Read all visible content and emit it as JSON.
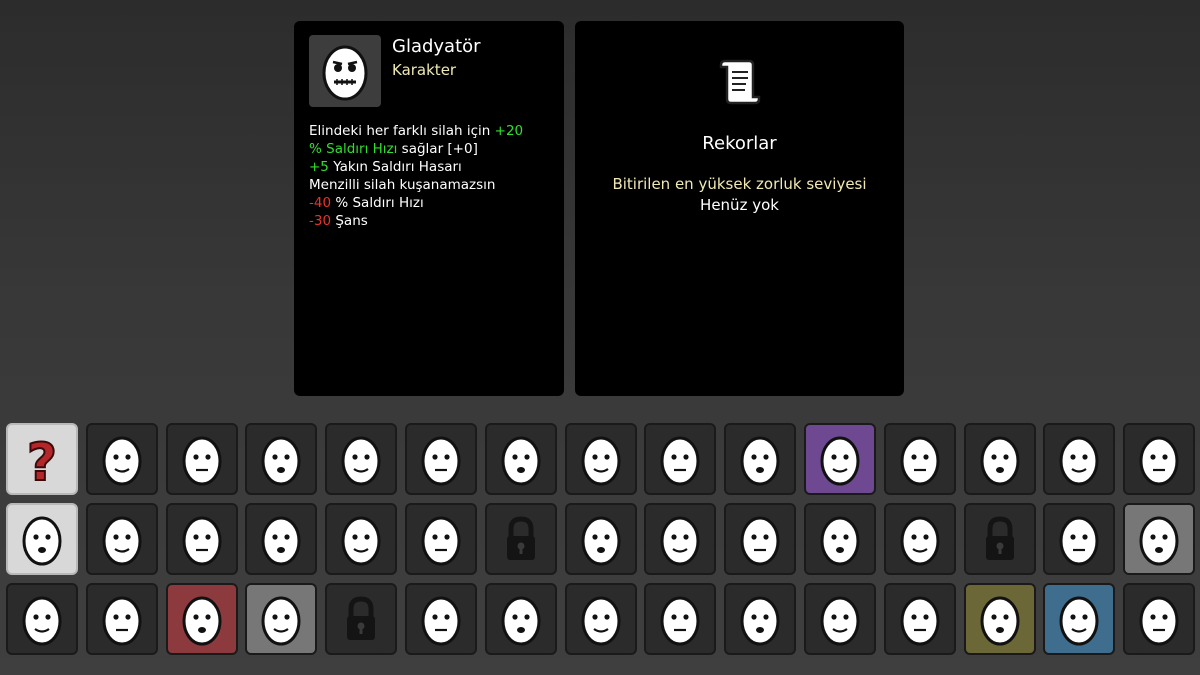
{
  "character": {
    "name": "Gladyatör",
    "type": "Karakter",
    "effects": [
      {
        "parts": [
          {
            "t": "Elindeki her farklı silah için ",
            "c": "w"
          },
          {
            "t": "+20",
            "c": "pos"
          }
        ]
      },
      {
        "parts": [
          {
            "t": "% Saldırı Hızı",
            "c": "pos"
          },
          {
            "t": " sağlar [+0]",
            "c": "w"
          }
        ]
      },
      {
        "parts": [
          {
            "t": "+5",
            "c": "pos"
          },
          {
            "t": " Yakın Saldırı Hasarı",
            "c": "w"
          }
        ]
      },
      {
        "parts": [
          {
            "t": "Menzilli silah kuşanamazsın",
            "c": "w"
          }
        ]
      },
      {
        "parts": [
          {
            "t": "-40",
            "c": "neg"
          },
          {
            "t": " % Saldırı Hızı",
            "c": "w"
          }
        ]
      },
      {
        "parts": [
          {
            "t": "-30",
            "c": "neg"
          },
          {
            "t": " Şans",
            "c": "w"
          }
        ]
      }
    ]
  },
  "records": {
    "title": "Rekorlar",
    "label": "Bitirilen en yüksek zorluk seviyesi",
    "value": "Henüz yok"
  },
  "colors": {
    "positive": "#2ee02e",
    "negative": "#e8322c",
    "accent_text": "#f0e9b2"
  },
  "grid": {
    "rows": [
      [
        {
          "name": "random-character",
          "bg": "sel",
          "icon": "question-mark-icon"
        },
        {
          "name": "character-flat",
          "bg": "",
          "icon": "potato-face-icon"
        },
        {
          "name": "character-bruised",
          "bg": "",
          "icon": "potato-face-icon"
        },
        {
          "name": "character-smirk",
          "bg": "",
          "icon": "potato-face-icon"
        },
        {
          "name": "character-monocle",
          "bg": "",
          "icon": "potato-face-icon"
        },
        {
          "name": "character-bearded-elder",
          "bg": "",
          "icon": "potato-face-icon"
        },
        {
          "name": "character-surprised",
          "bg": "",
          "icon": "potato-face-icon"
        },
        {
          "name": "character-mustache",
          "bg": "",
          "icon": "potato-face-icon"
        },
        {
          "name": "character-wide-eyed",
          "bg": "",
          "icon": "potato-face-icon"
        },
        {
          "name": "character-multi-eyed",
          "bg": "",
          "icon": "potato-face-icon"
        },
        {
          "name": "character-angry-bearded",
          "bg": "purple",
          "icon": "potato-face-icon"
        },
        {
          "name": "character-open-mouth",
          "bg": "",
          "icon": "potato-face-icon"
        },
        {
          "name": "character-happy",
          "bg": "",
          "icon": "potato-face-icon"
        },
        {
          "name": "character-sad",
          "bg": "",
          "icon": "potato-face-icon"
        },
        {
          "name": "character-heart-eyes",
          "bg": "",
          "icon": "potato-face-icon"
        }
      ],
      [
        {
          "name": "character-gladiator",
          "bg": "sel",
          "icon": "potato-face-icon"
        },
        {
          "name": "character-plain",
          "bg": "",
          "icon": "potato-face-icon"
        },
        {
          "name": "character-sweaty",
          "bg": "",
          "icon": "potato-face-icon"
        },
        {
          "name": "character-goatee",
          "bg": "",
          "icon": "potato-face-icon"
        },
        {
          "name": "character-crying",
          "bg": "",
          "icon": "potato-face-icon"
        },
        {
          "name": "character-sleepy",
          "bg": "",
          "icon": "potato-face-icon"
        },
        {
          "name": "character-locked-1",
          "bg": "locked",
          "icon": "lock-icon"
        },
        {
          "name": "character-knight",
          "bg": "",
          "icon": "potato-face-icon"
        },
        {
          "name": "character-hairy",
          "bg": "",
          "icon": "potato-face-icon"
        },
        {
          "name": "character-masked",
          "bg": "",
          "icon": "potato-face-icon"
        },
        {
          "name": "character-ninja",
          "bg": "",
          "icon": "potato-face-icon"
        },
        {
          "name": "character-glasses-grin",
          "bg": "",
          "icon": "potato-face-icon"
        },
        {
          "name": "character-locked-2",
          "bg": "locked",
          "icon": "lock-icon"
        },
        {
          "name": "character-nerd",
          "bg": "",
          "icon": "potato-face-icon"
        },
        {
          "name": "character-viking",
          "bg": "gray",
          "icon": "potato-face-icon"
        }
      ],
      [
        {
          "name": "character-drooling",
          "bg": "",
          "icon": "potato-face-icon"
        },
        {
          "name": "character-grumpy",
          "bg": "",
          "icon": "potato-face-icon"
        },
        {
          "name": "character-demon",
          "bg": "red",
          "icon": "potato-face-icon"
        },
        {
          "name": "character-ghost",
          "bg": "gray",
          "icon": "potato-face-icon"
        },
        {
          "name": "character-locked-3",
          "bg": "locked",
          "icon": "lock-icon"
        },
        {
          "name": "character-ranger",
          "bg": "",
          "icon": "potato-face-icon"
        },
        {
          "name": "character-rock",
          "bg": "",
          "icon": "potato-face-icon"
        },
        {
          "name": "character-king",
          "bg": "",
          "icon": "potato-face-icon"
        },
        {
          "name": "character-mutant",
          "bg": "",
          "icon": "potato-face-icon"
        },
        {
          "name": "character-calm",
          "bg": "",
          "icon": "potato-face-icon"
        },
        {
          "name": "character-spiked",
          "bg": "",
          "icon": "potato-face-icon"
        },
        {
          "name": "character-cool-shades",
          "bg": "",
          "icon": "potato-face-icon"
        },
        {
          "name": "character-furious",
          "bg": "olive",
          "icon": "potato-face-icon"
        },
        {
          "name": "character-chef",
          "bg": "blue",
          "icon": "potato-face-icon"
        },
        {
          "name": "character-horned",
          "bg": "",
          "icon": "potato-face-icon"
        }
      ]
    ]
  }
}
